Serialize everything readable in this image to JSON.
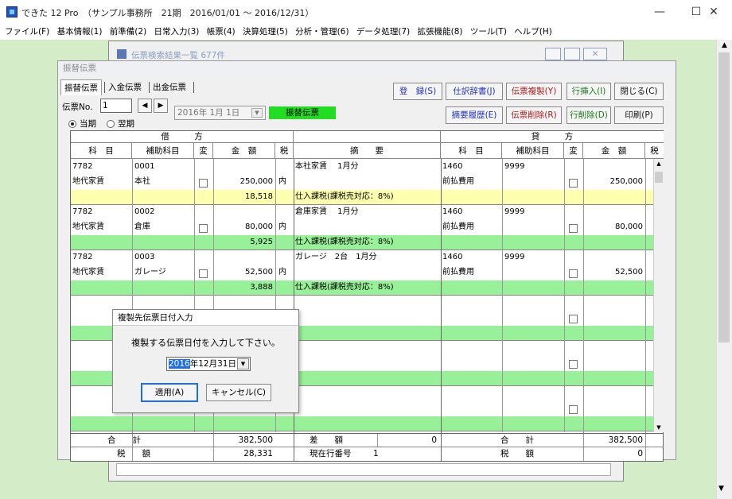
{
  "app": {
    "title": "できた 12 Pro　（サンプル事務所　21期　2016/01/01 ～ 2016/12/31）",
    "min_icon": "minimize-icon",
    "max_icon": "maximize-icon",
    "close_icon": "close-icon"
  },
  "menu": [
    "ファイル(F)",
    "基本情報(1)",
    "前準備(2)",
    "日常入力(3)",
    "帳票(4)",
    "決算処理(5)",
    "分析・管理(6)",
    "データ処理(7)",
    "拡張機能(8)",
    "ツール(T)",
    "ヘルプ(H)"
  ],
  "back_window": {
    "title": "伝票検索結果一覧  677件"
  },
  "window": {
    "title": "振替伝票"
  },
  "tabs": [
    "振替伝票",
    "入金伝票",
    "出金伝票"
  ],
  "voucher": {
    "no_label": "伝票No.",
    "no_value": "1",
    "date_value": "2016年  1月  1日",
    "type_badge": "振替伝票",
    "period_current": "当期",
    "period_next": "翌期"
  },
  "buttons": {
    "register": "登　録(S)",
    "dictionary": "仕訳辞書(J)",
    "copy": "伝票複製(Y)",
    "row_insert": "行挿入(I)",
    "close": "閉じる(C)",
    "summary_history": "摘要履歴(E)",
    "delete": "伝票削除(R)",
    "row_delete": "行削除(D)",
    "print": "印刷(P)"
  },
  "headers": {
    "debit": "借　　　方",
    "credit": "貸　　　方",
    "account": "科　目",
    "sub_account": "補助科目",
    "change": "変",
    "amount": "金　額",
    "tax": "税",
    "summary": "摘　　要"
  },
  "entries": [
    {
      "d_code": "7782",
      "d_name": "地代家賃",
      "d_sub_code": "0001",
      "d_sub_name": "本社",
      "d_amount": "250,000",
      "d_tax": "内",
      "d_tax_amount": "18,518",
      "summary": "本社家賃　 1月分",
      "tax_note": "仕入課税(課税売対応：8%)",
      "c_code": "1460",
      "c_name": "前払費用",
      "c_sub_code": "9999",
      "c_amount": "250,000",
      "band": "yellow"
    },
    {
      "d_code": "7782",
      "d_name": "地代家賃",
      "d_sub_code": "0002",
      "d_sub_name": "倉庫",
      "d_amount": "80,000",
      "d_tax": "内",
      "d_tax_amount": "5,925",
      "summary": "倉庫家賃　 1月分",
      "tax_note": "仕入課税(課税売対応：8%)",
      "c_code": "1460",
      "c_name": "前払費用",
      "c_sub_code": "9999",
      "c_amount": "80,000",
      "band": "green"
    },
    {
      "d_code": "7782",
      "d_name": "地代家賃",
      "d_sub_code": "0003",
      "d_sub_name": "ガレージ",
      "d_amount": "52,500",
      "d_tax": "内",
      "d_tax_amount": "3,888",
      "summary": "ガレージ　2台　1月分",
      "tax_note": "仕入課税(課税売対応：8%)",
      "c_code": "1460",
      "c_name": "前払費用",
      "c_sub_code": "9999",
      "c_amount": "52,500",
      "band": "green"
    }
  ],
  "footer": {
    "total_label": "合　　計",
    "debit_total": "382,500",
    "diff_label": "差　　額",
    "diff_value": "0",
    "credit_total_label": "合　　計",
    "credit_total": "382,500",
    "tax_label": "税　　額",
    "debit_tax": "28,331",
    "row_no_label": "現在行番号",
    "row_no_value": "1",
    "credit_tax_label": "税　　額",
    "credit_tax": "0"
  },
  "dialog": {
    "title": "複製先伝票日付入力",
    "message": "複製する伝票日付を入力して下さい。",
    "date_year": "2016",
    "date_rest": "年12月31日",
    "ok": "適用(A)",
    "cancel": "キャンセル(C)"
  },
  "colors": {
    "mdi_bg": "#d5ecc8",
    "tax_band_yellow": "#ffffb0",
    "tax_band_green": "#98f098",
    "badge_green": "#22dd22",
    "row_band": "#9cf09c"
  }
}
